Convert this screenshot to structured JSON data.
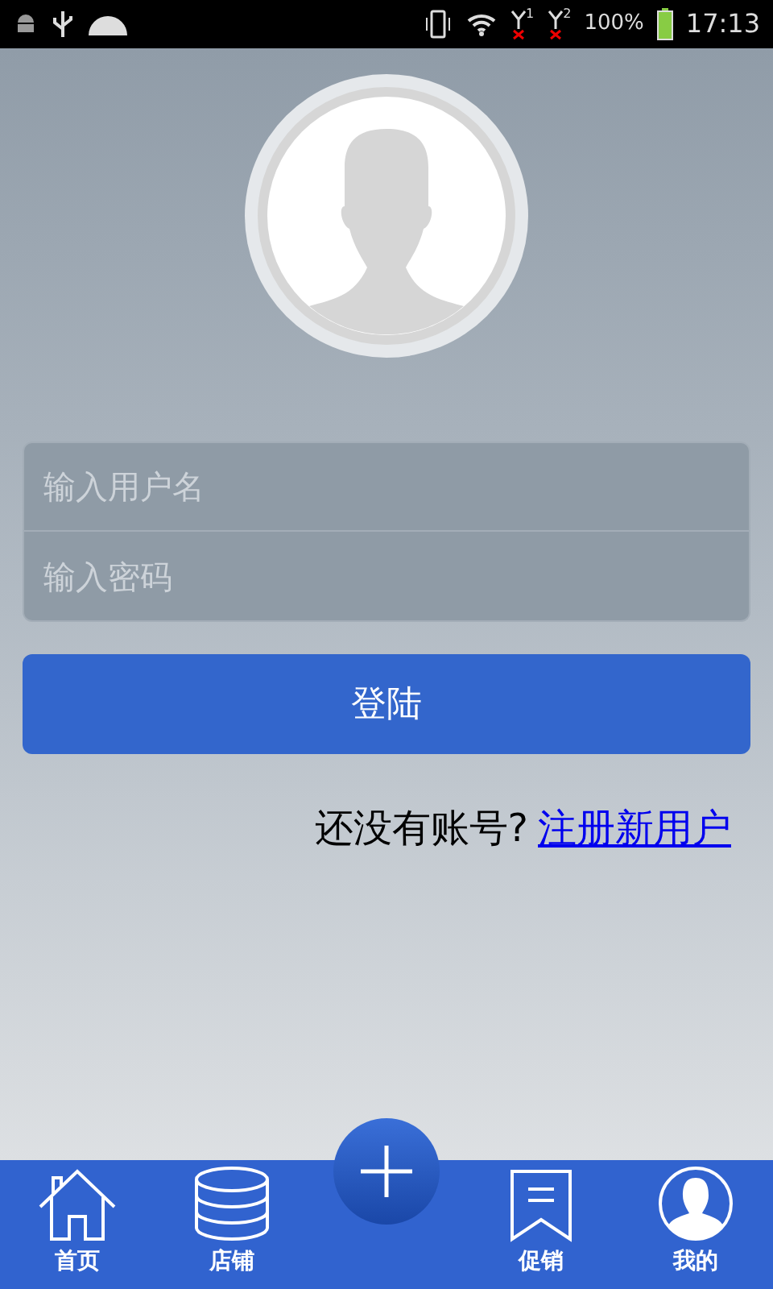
{
  "status_bar": {
    "sim_labels": [
      "1",
      "2"
    ],
    "battery": "100%",
    "time": "17:13"
  },
  "login_form": {
    "username": {
      "placeholder": "输入用户名"
    },
    "password": {
      "placeholder": "输入密码"
    }
  },
  "login_button": "登陆",
  "register_prompt": {
    "text": "还没有账号?",
    "link": "注册新用户"
  },
  "bottom_nav": [
    {
      "kind": "home",
      "label": "首页"
    },
    {
      "kind": "shop",
      "label": "店铺"
    },
    {
      "kind": "add"
    },
    {
      "kind": "promo",
      "label": "促销"
    },
    {
      "kind": "profile",
      "label": "我的"
    }
  ]
}
